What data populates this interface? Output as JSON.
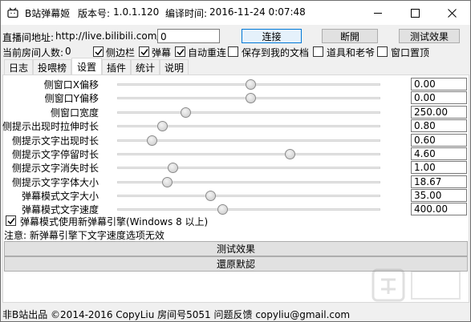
{
  "titlebar": {
    "app_name": "B站弹幕姬",
    "version_label": "版本号:",
    "version": "1.0.1.120",
    "build_label": "编译时间:",
    "build_time": "2016-11-24 0:07:48"
  },
  "url_row": {
    "label": "直播间地址:",
    "prefix": "http://live.bilibili.com/",
    "room_value": "0",
    "connect_label": "连接",
    "disconnect_label": "断開",
    "test_label": "测试效果"
  },
  "options_row": {
    "viewers_label": "当前房间人数:",
    "viewers_value": "0",
    "items": [
      {
        "label": "侧边栏",
        "checked": true
      },
      {
        "label": "弹幕",
        "checked": true
      },
      {
        "label": "自动重连",
        "checked": false
      },
      {
        "label": "保存到我的文档",
        "checked": false
      },
      {
        "label": "道具和老爷",
        "checked": false
      },
      {
        "label": "窗口置顶",
        "checked": false
      }
    ]
  },
  "tabs": [
    {
      "label": "日志",
      "active": false
    },
    {
      "label": "投喂榜",
      "active": false
    },
    {
      "label": "设置",
      "active": true
    },
    {
      "label": "插件",
      "active": false
    },
    {
      "label": "统计",
      "active": false
    },
    {
      "label": "说明",
      "active": false
    }
  ],
  "settings": [
    {
      "label": "侧窗口X偏移",
      "value": "0.00",
      "level": 0.505
    },
    {
      "label": "侧窗口Y偏移",
      "value": "0.00",
      "level": 0.505
    },
    {
      "label": "侧窗口宽度",
      "value": "250.00",
      "level": 0.26
    },
    {
      "label": "侧提示出现时拉伸时长",
      "value": "0.80",
      "level": 0.17
    },
    {
      "label": "侧提示文字出现时长",
      "value": "0.60",
      "level": 0.13
    },
    {
      "label": "侧提示文字停留时长",
      "value": "4.60",
      "level": 0.655
    },
    {
      "label": "侧提示文字消失时长",
      "value": "1.00",
      "level": 0.21
    },
    {
      "label": "侧提示文字字体大小",
      "value": "18.67",
      "level": 0.19
    },
    {
      "label": "弹幕模式文字大小",
      "value": "35.00",
      "level": 0.355
    },
    {
      "label": "弹幕模式文字速度",
      "value": "400.00",
      "level": 0.4
    }
  ],
  "new_engine": {
    "label": "弹幕模式使用新弹幕引擎(Windows 8 以上)",
    "checked": true
  },
  "note": "注意: 新弹幕引擎下文字速度选项无效",
  "buttons": {
    "test_label": "测试效果",
    "reset_label": "還原默認"
  },
  "statusbar": "非B站出品 ©2014-2016 CopyLiu 房间号5051 问题反馈 copyliu@gmail.com"
}
